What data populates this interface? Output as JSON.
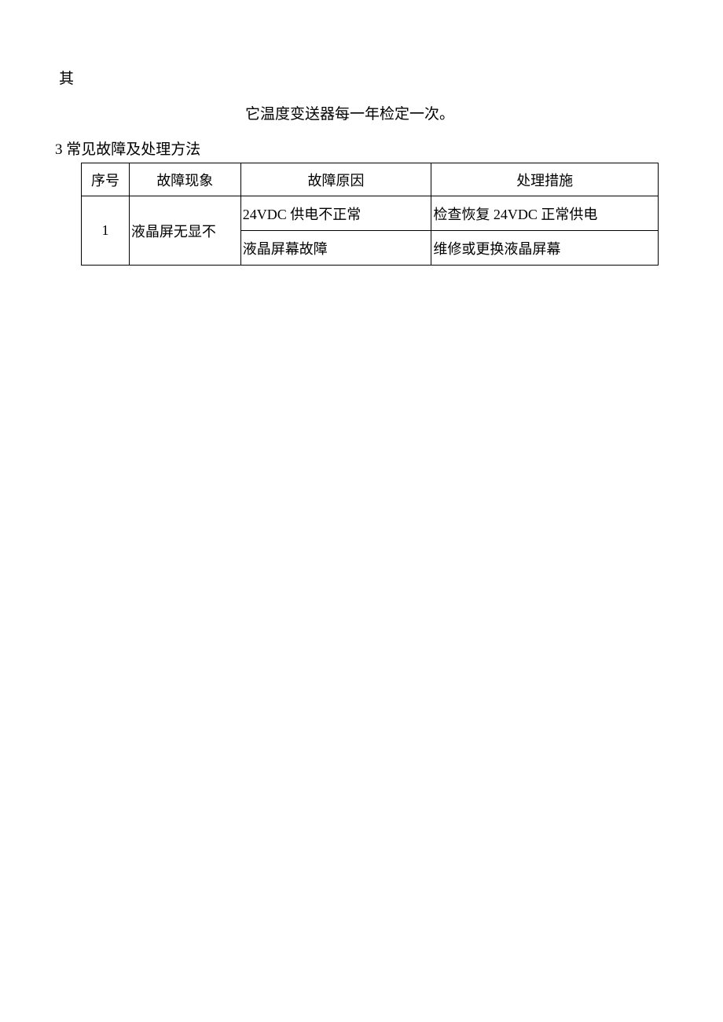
{
  "text": {
    "qi": "其",
    "line2": "它温度变送器每一年检定一次。",
    "section_title": "3 常见故障及处理方法"
  },
  "table": {
    "headers": {
      "col1": "序号",
      "col2": "故障现象",
      "col3": "故障原因",
      "col4": "处理措施"
    },
    "row1": {
      "num": "1",
      "phenomenon": "液晶屏无显不",
      "cause1": "24VDC 供电不正常",
      "measure1": "检查恢复 24VDC 正常供电",
      "cause2": "液晶屏幕故障",
      "measure2": "维修或更换液晶屏幕"
    }
  }
}
